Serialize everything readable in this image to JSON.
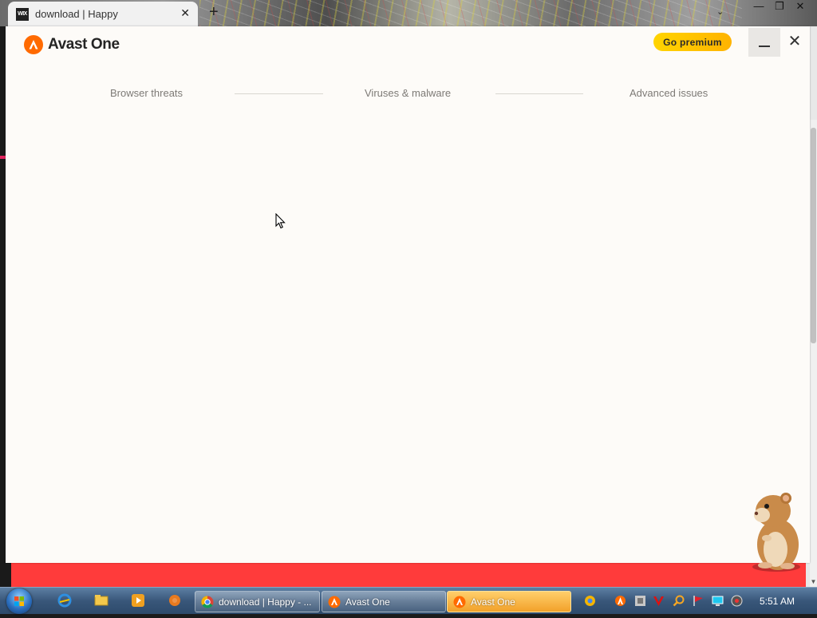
{
  "browser": {
    "tab_title": "download | Happy",
    "favicon_text": "WIX",
    "tab_close": "✕",
    "new_tab": "+"
  },
  "window": {
    "app_name": "Avast One",
    "premium_label": "Go premium",
    "close_glyph": "✕"
  },
  "steps": [
    {
      "label": "Browser threats"
    },
    {
      "label": "Viruses & malware"
    },
    {
      "label": "Advanced issues"
    }
  ],
  "taskbar": {
    "buttons": [
      {
        "label": "download | Happy - ...",
        "icon": "chrome-icon"
      },
      {
        "label": "Avast One",
        "icon": "avast-icon"
      },
      {
        "label": "Avast One",
        "icon": "avast-icon",
        "active": true
      }
    ],
    "clock": "5:51 AM"
  },
  "colors": {
    "avast_orange": "#ff6a00",
    "premium_yellow": "#ffc400",
    "window_bg": "#fdfbf8",
    "band_red": "#ff3b3b"
  }
}
